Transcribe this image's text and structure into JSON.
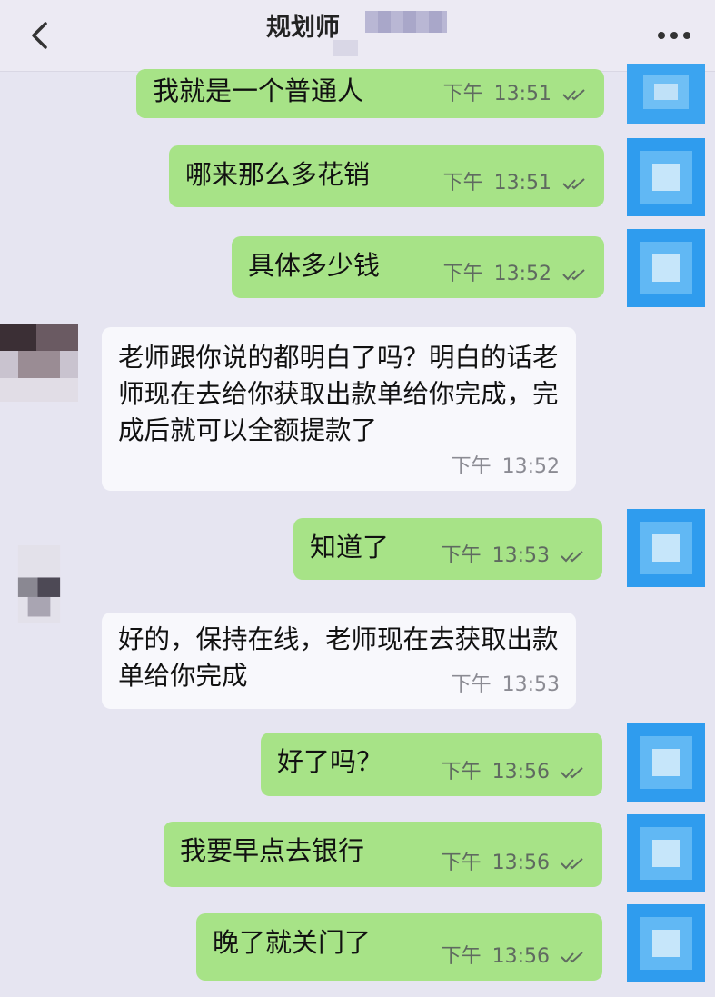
{
  "header": {
    "title": "规划师",
    "back_label": "<",
    "more_label": "..."
  },
  "messages": [
    {
      "dir": "out",
      "text": "我就是一个普通人",
      "period": "下午",
      "time": "13:51"
    },
    {
      "dir": "out",
      "text": "哪来那么多花销",
      "period": "下午",
      "time": "13:51"
    },
    {
      "dir": "out",
      "text": "具体多少钱",
      "period": "下午",
      "time": "13:52"
    },
    {
      "dir": "in",
      "text": "老师跟你说的都明白了吗？明白的话老师现在去给你获取出款单给你完成，完成后就可以全额提款了",
      "period": "下午",
      "time": "13:52"
    },
    {
      "dir": "out",
      "text": "知道了",
      "period": "下午",
      "time": "13:53"
    },
    {
      "dir": "in",
      "text": "好的，保持在线，老师现在去获取出款单给你完成",
      "period": "下午",
      "time": "13:53"
    },
    {
      "dir": "out",
      "text": "好了吗？",
      "period": "下午",
      "time": "13:56"
    },
    {
      "dir": "out",
      "text": "我要早点去银行",
      "period": "下午",
      "time": "13:56"
    },
    {
      "dir": "out",
      "text": "晚了就关门了",
      "period": "下午",
      "time": "13:56"
    }
  ],
  "colors": {
    "outgoing_bubble": "#a7e387",
    "incoming_bubble": "#f8f8fc",
    "background": "#e6e5f1"
  }
}
